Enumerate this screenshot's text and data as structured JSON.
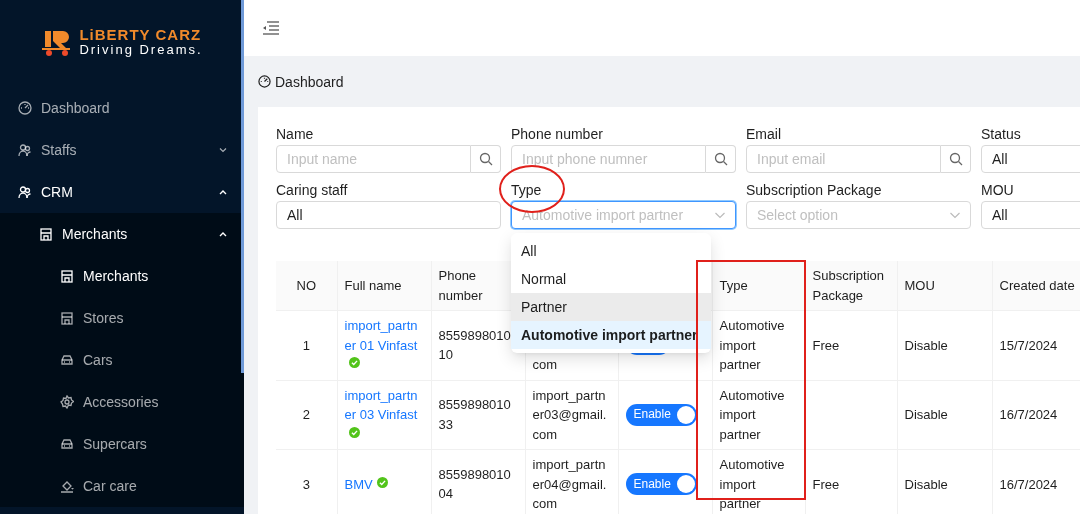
{
  "sidebar": {
    "logo": {
      "title": "LiBERTY CARZ",
      "tagline": "Driving Dreams."
    },
    "menu": [
      {
        "label": "Dashboard",
        "selected": false
      },
      {
        "label": "Staffs",
        "selected": false,
        "expanded": false
      },
      {
        "label": "CRM",
        "expanded": true,
        "children": [
          {
            "label": "Merchants",
            "expanded": true,
            "children": [
              {
                "label": "Merchants",
                "selected": true
              },
              {
                "label": "Stores",
                "selected": false
              },
              {
                "label": "Cars",
                "selected": false
              },
              {
                "label": "Accessories",
                "selected": false
              },
              {
                "label": "Supercars",
                "selected": false
              },
              {
                "label": "Car care",
                "selected": false
              }
            ]
          }
        ]
      }
    ]
  },
  "breadcrumb": "Dashboard",
  "filters": [
    {
      "label": "Name",
      "kind": "search",
      "placeholder": "Input name"
    },
    {
      "label": "Phone number",
      "kind": "search",
      "placeholder": "Input phone numner"
    },
    {
      "label": "Email",
      "kind": "search",
      "placeholder": "Input email"
    },
    {
      "label": "Status",
      "kind": "select",
      "value": "All"
    },
    {
      "label": "Caring staff",
      "kind": "select",
      "value": "All"
    },
    {
      "label": "Type",
      "kind": "select",
      "placeholder": "Automotive import partner",
      "focused": true,
      "circled": true
    },
    {
      "label": "Subscription Package",
      "kind": "select",
      "placeholder": "Select option"
    },
    {
      "label": "MOU",
      "kind": "select",
      "value": "All"
    }
  ],
  "dropdown": {
    "options": [
      {
        "label": "All",
        "selected": false,
        "hovered": false
      },
      {
        "label": "Normal",
        "selected": false,
        "hovered": false
      },
      {
        "label": "Partner",
        "selected": false,
        "hovered": true
      },
      {
        "label": "Automotive import partner",
        "selected": true,
        "hovered": false
      }
    ]
  },
  "table": {
    "columns": [
      {
        "label": "NO",
        "highlighted": false
      },
      {
        "label": "Full name",
        "highlighted": false
      },
      {
        "label": "Phone number",
        "highlighted": false
      },
      {},
      {},
      {
        "label": "Type",
        "highlighted": true
      },
      {
        "label": "Subscription Package",
        "highlighted": false
      },
      {
        "label": "MOU",
        "highlighted": false
      },
      {
        "label": "Created date",
        "highlighted": false
      }
    ],
    "rows": [
      {
        "no": "1",
        "name": "import_partner 01 Vinfast",
        "verified": true,
        "phone": "855989801010",
        "email": "com",
        "status": {
          "on": true
        },
        "type": "Automotive import partner",
        "subscription": "Free",
        "mou": "Disable",
        "created": "15/7/2024"
      },
      {
        "no": "2",
        "name": "import_partner 03 Vinfast",
        "verified": true,
        "phone": "855989801033",
        "email": "import_partner03@gmail.com",
        "status": {
          "on": true,
          "label": "Enable"
        },
        "type": "Automotive import partner",
        "mou": "Disable",
        "created": "16/7/2024"
      },
      {
        "no": "3",
        "name": "BMV",
        "verified": true,
        "phone": "855989801004",
        "email": "import_partner04@gmail.com",
        "status": {
          "on": true,
          "label": "Enable"
        },
        "type": "Automotive import partner",
        "subscription": "Free",
        "mou": "Disable",
        "created": "16/7/2024"
      }
    ]
  }
}
